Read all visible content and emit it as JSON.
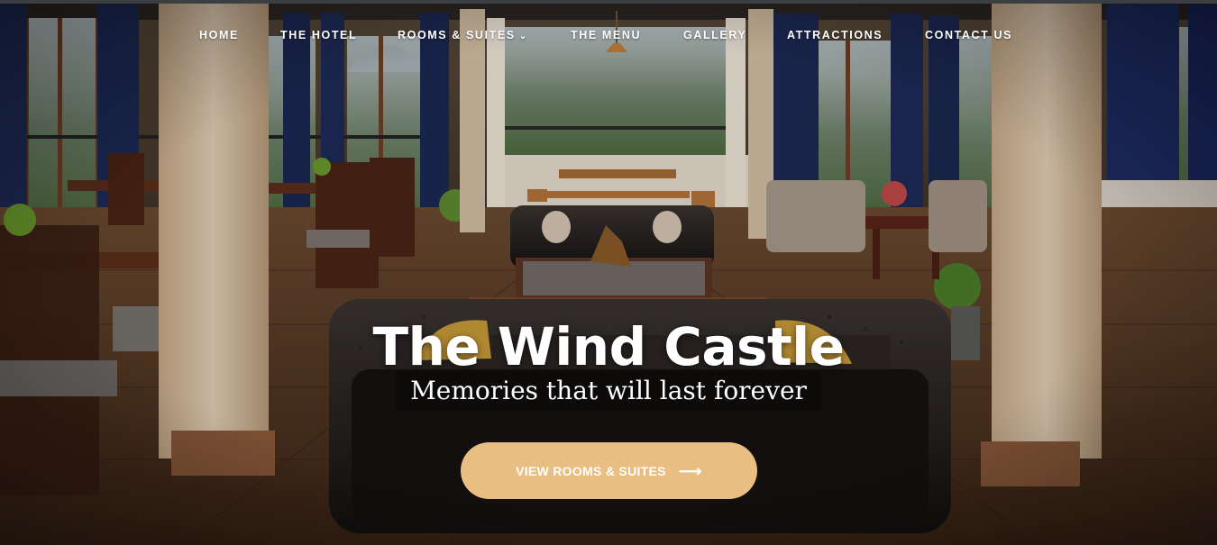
{
  "nav": {
    "items": [
      {
        "label": "HOME"
      },
      {
        "label": "THE HOTEL"
      },
      {
        "label": "ROOMS & SUITES",
        "dropdown_icon": "chevron-down-icon"
      },
      {
        "label": "THE MENU"
      },
      {
        "label": "GALLERY"
      },
      {
        "label": "ATTRACTIONS"
      },
      {
        "label": "CONTACT US"
      }
    ]
  },
  "hero": {
    "title": "The Wind Castle",
    "subtitle": "Memories that will last forever",
    "cta_label": "VIEW ROOMS & SUITES",
    "cta_icon": "arrow-right-icon"
  },
  "colors": {
    "cta_background": "#e8be82",
    "text": "#ffffff",
    "floor": "#5a3a22",
    "pillar": "#d8c0a2"
  }
}
